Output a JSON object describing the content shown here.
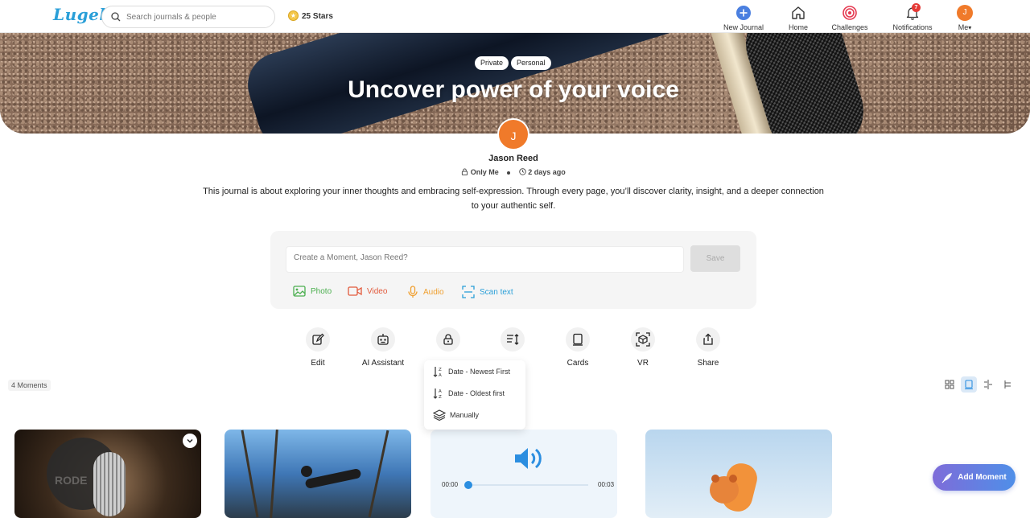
{
  "header": {
    "logo": "Lugelo",
    "search_placeholder": "Search journals & people",
    "stars": "25 Stars",
    "nav": [
      {
        "label": "New Journal",
        "icon": "plus-circle-icon"
      },
      {
        "label": "Home",
        "icon": "home-icon"
      },
      {
        "label": "Challenges",
        "icon": "target-icon"
      },
      {
        "label": "Notifications",
        "icon": "bell-icon",
        "badge": "7"
      },
      {
        "label": "Me",
        "icon": "avatar",
        "avatar_letter": "J"
      }
    ]
  },
  "journal": {
    "tags": [
      "Private",
      "Personal"
    ],
    "title": "Uncover power of your voice",
    "author_initial": "J",
    "author": "Jason Reed",
    "visibility": "Only Me",
    "time": "2 days ago",
    "description": "This journal is about exploring your inner thoughts and embracing self-expression. Through every page, you’ll discover clarity, insight, and a deeper connection to your authentic self."
  },
  "composer": {
    "placeholder": "Create a Moment, Jason Reed?",
    "save_label": "Save",
    "media": [
      {
        "label": "Photo",
        "color": "#4caf50"
      },
      {
        "label": "Video",
        "color": "#e25a3c"
      },
      {
        "label": "Audio",
        "color": "#f0a030"
      },
      {
        "label": "Scan text",
        "color": "#2a9fd8"
      }
    ]
  },
  "actions": [
    {
      "label": "Edit",
      "icon": "edit-icon"
    },
    {
      "label": "AI Assistant",
      "icon": "robot-icon"
    },
    {
      "label": "",
      "icon": "lock-icon"
    },
    {
      "label": "",
      "icon": "sort-icon"
    },
    {
      "label": "Cards",
      "icon": "cards-icon"
    },
    {
      "label": "VR",
      "icon": "vr-icon"
    },
    {
      "label": "Share",
      "icon": "share-icon"
    }
  ],
  "sort_menu": {
    "items": [
      "Date - Newest First",
      "Date - Oldest first",
      "Manually"
    ]
  },
  "moments": {
    "count_label": "4 Moments",
    "audio": {
      "current": "00:00",
      "duration": "00:03",
      "progress": 0.0
    }
  },
  "fab": {
    "label": "Add Moment"
  }
}
